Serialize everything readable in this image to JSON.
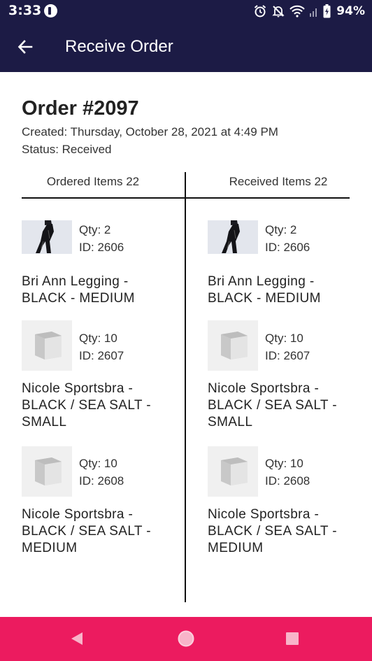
{
  "status_bar": {
    "time": "3:33",
    "battery_percent": "94%",
    "icons": [
      "notification-icon",
      "alarm-icon",
      "notifications-off-icon",
      "wifi-icon",
      "signal-icon",
      "battery-icon"
    ]
  },
  "app_bar": {
    "title": "Receive Order",
    "back_icon": "arrow-left-icon"
  },
  "order": {
    "title": "Order #2097",
    "created": "Created: Thursday, October 28, 2021 at 4:49 PM",
    "status": "Status: Received"
  },
  "columns": {
    "ordered_header": "Ordered Items 22",
    "received_header": "Received Items 22"
  },
  "ordered_items": [
    {
      "qty": "Qty: 2",
      "id": "ID: 2606",
      "name_line1": "Bri Ann Legging -",
      "name_line2": "BLACK - MEDIUM",
      "name_line3": "",
      "image": "product-photo"
    },
    {
      "qty": "Qty: 10",
      "id": "ID: 2607",
      "name_line1": "Nicole Sportsbra -",
      "name_line2": "BLACK / SEA SALT -",
      "name_line3": "SMALL",
      "image": "placeholder-box-icon"
    },
    {
      "qty": "Qty: 10",
      "id": "ID: 2608",
      "name_line1": "Nicole Sportsbra -",
      "name_line2": "BLACK / SEA SALT -",
      "name_line3": "MEDIUM",
      "image": "placeholder-box-icon"
    }
  ],
  "received_items": [
    {
      "qty": "Qty: 2",
      "id": "ID: 2606",
      "name_line1": "Bri Ann Legging -",
      "name_line2": "BLACK - MEDIUM",
      "name_line3": "",
      "image": "product-photo"
    },
    {
      "qty": "Qty: 10",
      "id": "ID: 2607",
      "name_line1": "Nicole Sportsbra -",
      "name_line2": "BLACK / SEA SALT -",
      "name_line3": "SMALL",
      "image": "placeholder-box-icon"
    },
    {
      "qty": "Qty: 10",
      "id": "ID: 2608",
      "name_line1": "Nicole Sportsbra -",
      "name_line2": "BLACK / SEA SALT -",
      "name_line3": "MEDIUM",
      "image": "placeholder-box-icon"
    }
  ],
  "nav_bar": {
    "icons": [
      "back-triangle-icon",
      "home-circle-icon",
      "recents-square-icon"
    ]
  },
  "colors": {
    "app_bar": "#1c1b45",
    "nav_bar": "#ec1b5f",
    "nav_icon": "#f8b4c9"
  }
}
